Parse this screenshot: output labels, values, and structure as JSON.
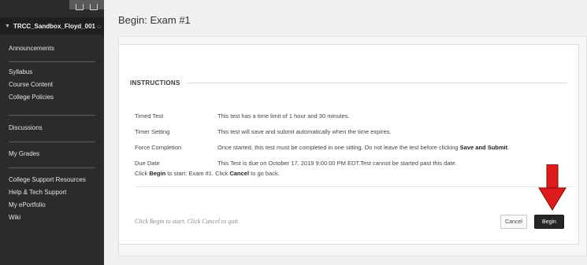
{
  "sidebar": {
    "course_name": "TRCC_Sandbox_Floyd_001",
    "groups": [
      {
        "items": [
          {
            "label": "Announcements"
          }
        ]
      },
      {
        "items": [
          {
            "label": "Syllabus"
          },
          {
            "label": "Course Content"
          },
          {
            "label": "College Policies"
          }
        ]
      },
      {
        "items": [
          {
            "label": "Discussions"
          }
        ]
      },
      {
        "items": [
          {
            "label": "My Grades"
          }
        ]
      },
      {
        "items": [
          {
            "label": "College Support Resources"
          },
          {
            "label": "Help & Tech Support"
          },
          {
            "label": "My ePortfolio"
          },
          {
            "label": "Wiki"
          }
        ]
      }
    ]
  },
  "main": {
    "page_title": "Begin: Exam #1",
    "instructions": {
      "heading": "INSTRUCTIONS",
      "rows": [
        {
          "key": "Timed Test",
          "value": "This test has a time limit of 1 hour and 30 minutes."
        },
        {
          "key": "Timer Setting",
          "value": "This test will save and submit automatically when the time expires."
        },
        {
          "key": "Force Completion",
          "value_pre": "Once started, this test must be completed in one sitting. Do not leave the test before clicking ",
          "value_bold": "Save and Submit",
          "value_post": "."
        },
        {
          "key": "Due Date",
          "value": "This Test is due on October 17, 2019 9:00:00 PM EDT.Test cannot be started past this date."
        }
      ],
      "click_line": {
        "pre": "Click ",
        "begin": "Begin",
        "mid": " to start: Exam #1. Click ",
        "cancel": "Cancel",
        "post": " to go back."
      }
    },
    "footer_note": "Click Begin to start. Click Cancel to quit.",
    "cancel_label": "Cancel",
    "begin_label": "Begin"
  },
  "colors": {
    "sidebar_bg": "#2b2b2b",
    "begin_button_bg": "#262626",
    "annotation_arrow": "#e01b1b"
  }
}
